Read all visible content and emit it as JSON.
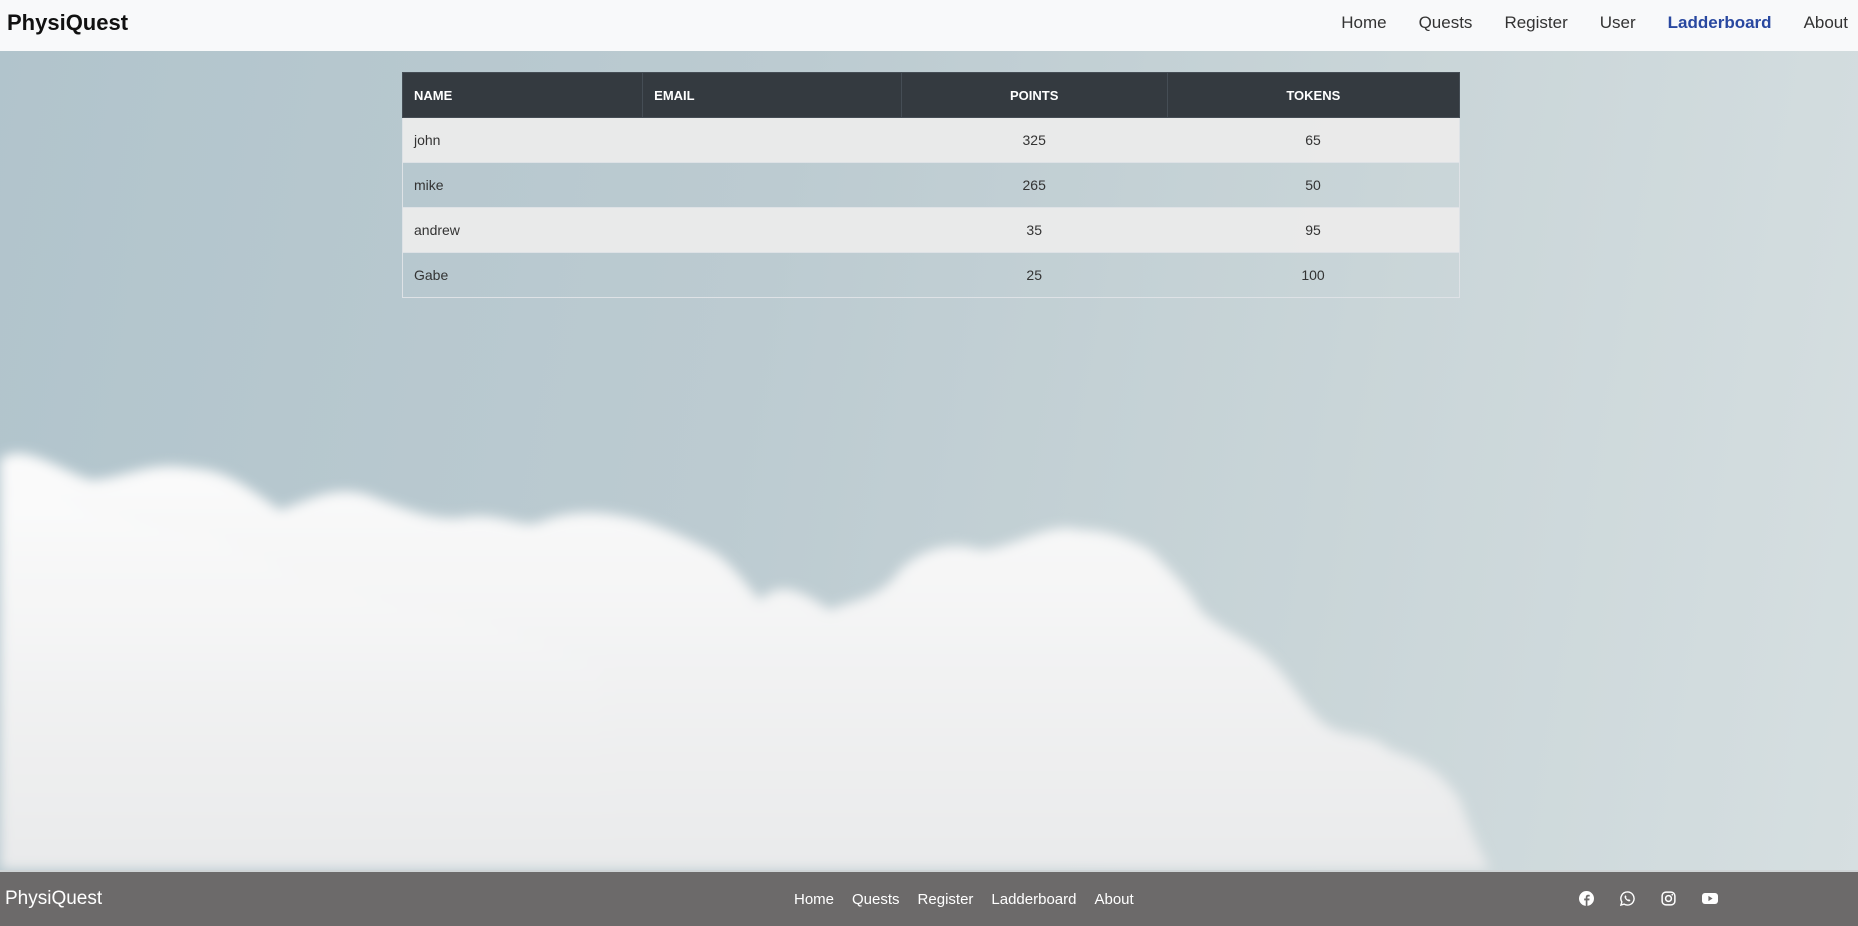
{
  "nav": {
    "brand": "PhysiQuest",
    "links": [
      {
        "label": "Home",
        "active": false
      },
      {
        "label": "Quests",
        "active": false
      },
      {
        "label": "Register",
        "active": false
      },
      {
        "label": "User",
        "active": false
      },
      {
        "label": "Ladderboard",
        "active": true
      },
      {
        "label": "About",
        "active": false
      }
    ],
    "active_color": "#2948a0"
  },
  "table": {
    "headers": [
      "NAME",
      "EMAIL",
      "POINTS",
      "TOKENS"
    ],
    "rows": [
      {
        "name": "john",
        "email": "",
        "points": "325",
        "tokens": "65"
      },
      {
        "name": "mike",
        "email": "",
        "points": "265",
        "tokens": "50"
      },
      {
        "name": "andrew",
        "email": "",
        "points": "35",
        "tokens": "95"
      },
      {
        "name": "Gabe",
        "email": "",
        "points": "25",
        "tokens": "100"
      }
    ],
    "header_bg": "#343a40"
  },
  "footer": {
    "brand": "PhysiQuest",
    "links": [
      "Home",
      "Quests",
      "Register",
      "Ladderboard",
      "About"
    ],
    "social": [
      "facebook-icon",
      "whatsapp-icon",
      "instagram-icon",
      "youtube-icon"
    ],
    "bg": "#6c6a6a"
  }
}
